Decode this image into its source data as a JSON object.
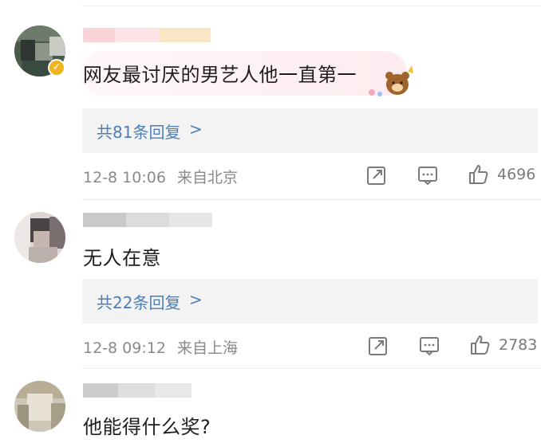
{
  "comments": [
    {
      "text": "网友最讨厌的男艺人他一直第一",
      "reply_label": "共81条回复",
      "time": "12-8 10:06",
      "location": "来自北京",
      "likes": "4696",
      "verified": true,
      "has_sticker": true
    },
    {
      "text": "无人在意",
      "reply_label": "共22条回复",
      "time": "12-8 09:12",
      "location": "来自上海",
      "likes": "2783",
      "verified": false,
      "has_sticker": false
    },
    {
      "text": "他能得什么奖?",
      "verified": false,
      "has_sticker": false
    }
  ],
  "ui": {
    "chevron": ">",
    "colors": {
      "link": "#4e7eb3",
      "meta": "#8a8a8a",
      "text": "#1d1d1d",
      "reply_bg": "#f3f3f3",
      "verified": "#f2b41d"
    },
    "icons": {
      "share": "share-icon",
      "comment": "comment-icon",
      "like": "thumbs-up-icon",
      "verified": "verified-badge-icon",
      "chevron": "chevron-right-icon"
    }
  }
}
